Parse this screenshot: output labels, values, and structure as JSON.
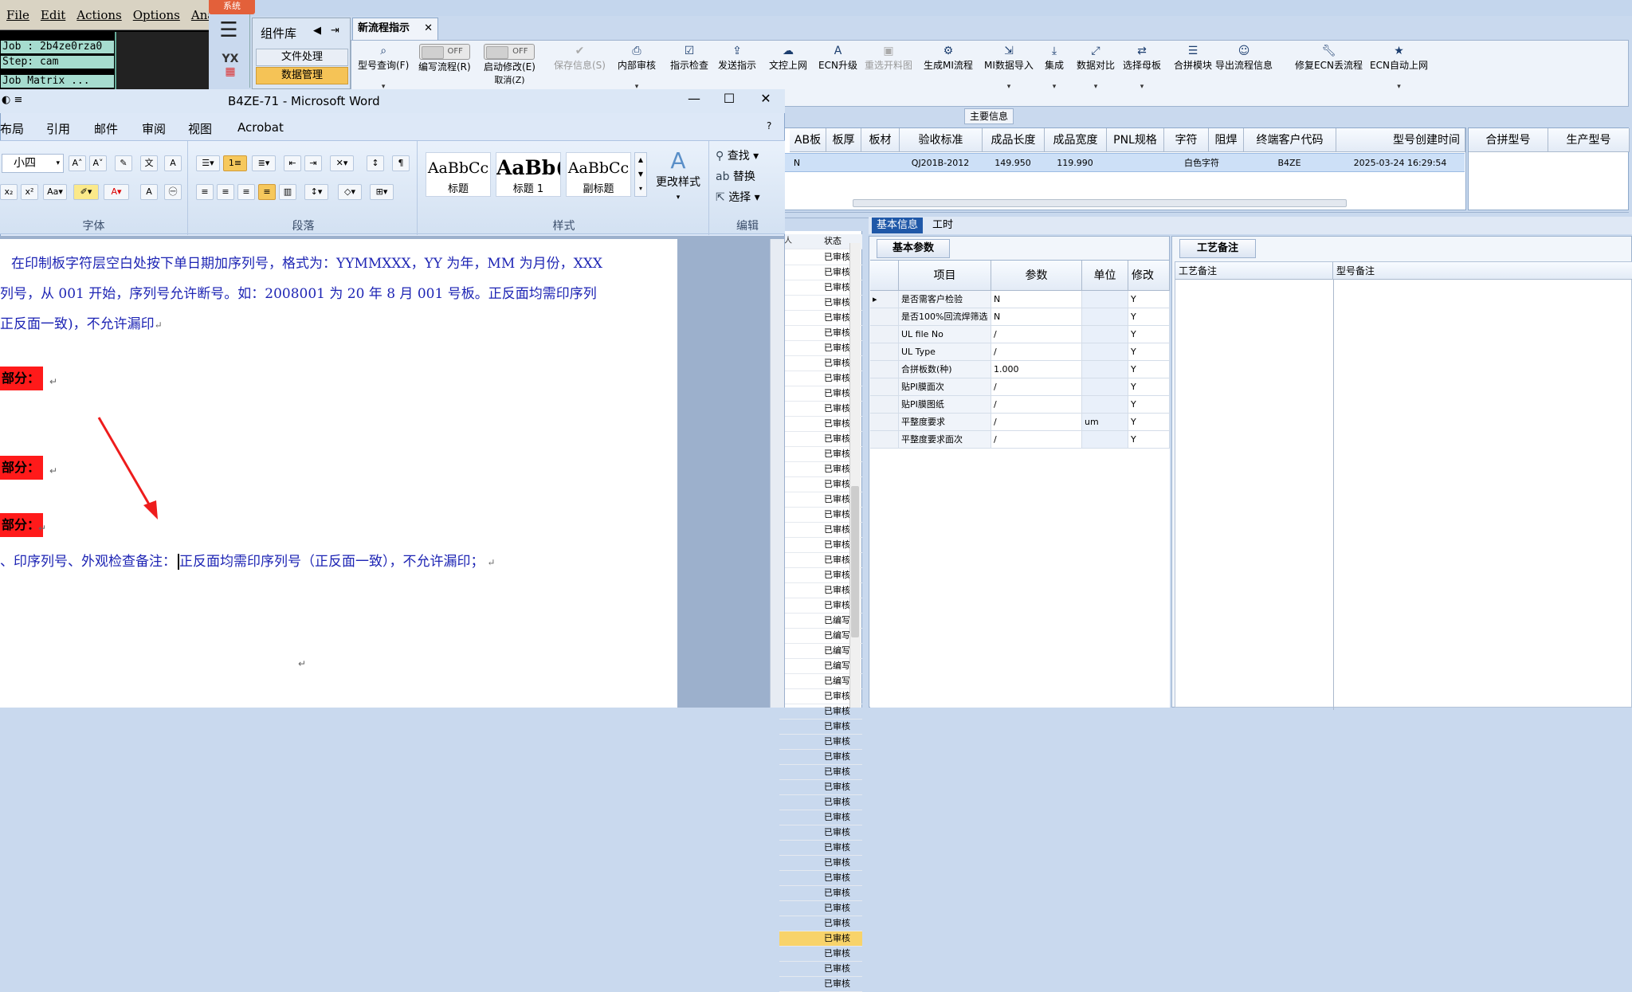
{
  "cam": {
    "menu": [
      "File",
      "Edit",
      "Actions",
      "Options",
      "Analy"
    ],
    "lines": [
      "Job : 2b4ze0rza0",
      "Step: cam",
      "Job Matrix ..."
    ]
  },
  "erp": {
    "system_btn": "系统",
    "component_lib": "组件库",
    "lib_items": [
      "文件处理",
      "数据管理"
    ],
    "logo": "YX",
    "tab_title": "新流程指示",
    "ribbon": [
      {
        "label": "型号查询(F)",
        "icon": "search-icon",
        "disabled": false
      },
      {
        "label": "编写流程(R)",
        "icon": "toggle",
        "disabled": false,
        "toggle": "OFF"
      },
      {
        "label": "启动修改(E)",
        "icon": "toggle",
        "disabled": false,
        "toggle": "OFF"
      },
      {
        "label": "保存信息(S)",
        "icon": "check-icon",
        "disabled": true
      },
      {
        "label": "内部审核",
        "icon": "print-icon",
        "disabled": false
      },
      {
        "label": "指示检查",
        "icon": "checklist-icon",
        "disabled": false
      },
      {
        "label": "发送指示",
        "icon": "upload-icon",
        "disabled": false
      },
      {
        "label": "文控上网",
        "icon": "cloud-icon",
        "disabled": false
      },
      {
        "label": "ECN升级",
        "icon": "font-icon",
        "disabled": false
      },
      {
        "label": "重选开料图",
        "icon": "image-icon",
        "disabled": true
      },
      {
        "label": "生成MI流程",
        "icon": "cogs-icon",
        "disabled": false
      },
      {
        "label": "MI数据导入",
        "icon": "import-icon",
        "disabled": false
      },
      {
        "label": "集成",
        "icon": "download-icon",
        "disabled": false
      },
      {
        "label": "数据对比",
        "icon": "compare-icon",
        "disabled": false
      },
      {
        "label": "选择母板",
        "icon": "shuffle-icon",
        "disabled": false
      },
      {
        "label": "合拼模块",
        "icon": "list-icon",
        "disabled": false
      },
      {
        "label": "导出流程信息",
        "icon": "smile-icon",
        "disabled": false
      },
      {
        "label": "修复ECN丢流程",
        "icon": "wrench-icon",
        "disabled": false
      },
      {
        "label": "ECN自动上网",
        "icon": "star-icon",
        "disabled": false
      }
    ],
    "toggle_row2_label": "取消(Z)",
    "main_info_label": "主要信息",
    "main_grid": {
      "headers": [
        "AB板",
        "板厚",
        "板材",
        "验收标准",
        "成品长度",
        "成品宽度",
        "PNL规格",
        "字符",
        "阻焊",
        "终端客户代码",
        "型号创建时间"
      ],
      "row": [
        "N",
        "",
        "",
        "QJ201B-2012",
        "149.950",
        "119.990",
        "",
        "白色字符",
        "",
        "B4ZE",
        "2025-03-24 16:29:54"
      ]
    },
    "right_grid_headers": [
      "合拼型号",
      "生产型号"
    ],
    "status_list": {
      "headers": [
        "人",
        "状态"
      ],
      "rows": [
        {
          "a": "",
          "b": "已审核"
        },
        {
          "a": "",
          "b": "已审核"
        },
        {
          "a": "",
          "b": "已审核"
        },
        {
          "a": "",
          "b": "已审核"
        },
        {
          "a": "",
          "b": "已审核"
        },
        {
          "a": "",
          "b": "已审核"
        },
        {
          "a": "",
          "b": "已审核"
        },
        {
          "a": "",
          "b": "已审核"
        },
        {
          "a": "",
          "b": "已审核"
        },
        {
          "a": "",
          "b": "已审核"
        },
        {
          "a": "",
          "b": "已审核"
        },
        {
          "a": "",
          "b": "已审核"
        },
        {
          "a": "",
          "b": "已审核"
        },
        {
          "a": "",
          "b": "已审核"
        },
        {
          "a": "",
          "b": "已审核"
        },
        {
          "a": "",
          "b": "已审核"
        },
        {
          "a": "",
          "b": "已审核"
        },
        {
          "a": "",
          "b": "已审核"
        },
        {
          "a": "",
          "b": "已审核"
        },
        {
          "a": "",
          "b": "已审核"
        },
        {
          "a": "",
          "b": "已审核"
        },
        {
          "a": "",
          "b": "已审核"
        },
        {
          "a": "",
          "b": "已审核"
        },
        {
          "a": "",
          "b": "已审核"
        },
        {
          "a": "",
          "b": "已编写"
        },
        {
          "a": "",
          "b": "已编写"
        },
        {
          "a": "",
          "b": "已编写"
        },
        {
          "a": "",
          "b": "已编写"
        },
        {
          "a": "",
          "b": "已编写"
        },
        {
          "a": "",
          "b": "已审核"
        },
        {
          "a": "",
          "b": "已审核"
        },
        {
          "a": "",
          "b": "已审核"
        },
        {
          "a": "",
          "b": "已审核"
        },
        {
          "a": "",
          "b": "已审核"
        },
        {
          "a": "",
          "b": "已审核"
        },
        {
          "a": "",
          "b": "已审核"
        },
        {
          "a": "",
          "b": "已审核"
        },
        {
          "a": "",
          "b": "已审核"
        },
        {
          "a": "",
          "b": "已审核"
        },
        {
          "a": "",
          "b": "已审核"
        },
        {
          "a": "",
          "b": "已审核"
        },
        {
          "a": "",
          "b": "已审核"
        },
        {
          "a": "",
          "b": "已审核"
        },
        {
          "a": "",
          "b": "已审核"
        },
        {
          "a": "",
          "b": "已审核"
        },
        {
          "a": "",
          "b": "已审核"
        },
        {
          "a": "",
          "b": "已审核"
        },
        {
          "a": "",
          "b": "已审核"
        },
        {
          "a": "",
          "b": "已审核"
        }
      ]
    },
    "detail_tabs": [
      "基本信息",
      "工时"
    ],
    "basic_tab": "基本参数",
    "param_headers": [
      "项目",
      "参数",
      "单位",
      "修改"
    ],
    "params": [
      {
        "item": "是否需客户检验",
        "value": "N",
        "unit": "",
        "mod": "Y"
      },
      {
        "item": "是否100%回流焊筛选",
        "value": "N",
        "unit": "",
        "mod": "Y"
      },
      {
        "item": "UL file No",
        "value": "/",
        "unit": "",
        "mod": "Y"
      },
      {
        "item": "UL Type",
        "value": "/",
        "unit": "",
        "mod": "Y"
      },
      {
        "item": "合拼板数(种)",
        "value": "1.000",
        "unit": "",
        "mod": "Y"
      },
      {
        "item": "贴PI膜面次",
        "value": "/",
        "unit": "",
        "mod": "Y"
      },
      {
        "item": "贴PI膜图纸",
        "value": "/",
        "unit": "",
        "mod": "Y"
      },
      {
        "item": "平整度要求",
        "value": "/",
        "unit": "um",
        "mod": "Y"
      },
      {
        "item": "平整度要求面次",
        "value": "/",
        "unit": "",
        "mod": "Y"
      }
    ],
    "proc_tab": "工艺备注",
    "proc_headers": [
      "工艺备注",
      "型号备注"
    ]
  },
  "word": {
    "title": "B4ZE-71 - Microsoft Word",
    "tabs": [
      "布局",
      "引用",
      "邮件",
      "审阅",
      "视图",
      "Acrobat"
    ],
    "font_size": "小四",
    "groups": [
      "字体",
      "段落",
      "样式",
      "编辑"
    ],
    "styles": [
      {
        "sample": "AaBbCc",
        "name": "标题"
      },
      {
        "sample": "AaBb(",
        "name": "标题 1"
      },
      {
        "sample": "AaBbCc",
        "name": "副标题"
      }
    ],
    "change_styles": "更改样式",
    "editing": [
      "查找",
      "替换",
      "选择"
    ],
    "doc": {
      "line1": "在印制板字符层空白处按下单日期加序列号，格式为：YYMMXXX，YY 为年，MM 为月份，XXX",
      "line2": "列号，从 001 开始，序列号允许断号。如：2008001 为 20 年 8 月 001 号板。正反面均需印序列",
      "line3": "正反面一致)，不允许漏印",
      "red1": "部分：",
      "red2": "部分：",
      "red3": "部分：",
      "line4a": "、印序列号、外观检查备注：",
      "line4b": "正反面均需印序列号（正反面一致），不允许漏印；"
    }
  },
  "colors": {
    "accent": "#1f58a8",
    "highlight": "#f5c356",
    "red_label": "#ff1a1a",
    "doc_text": "#1d24b4",
    "arrow": "#ee1c1c"
  }
}
